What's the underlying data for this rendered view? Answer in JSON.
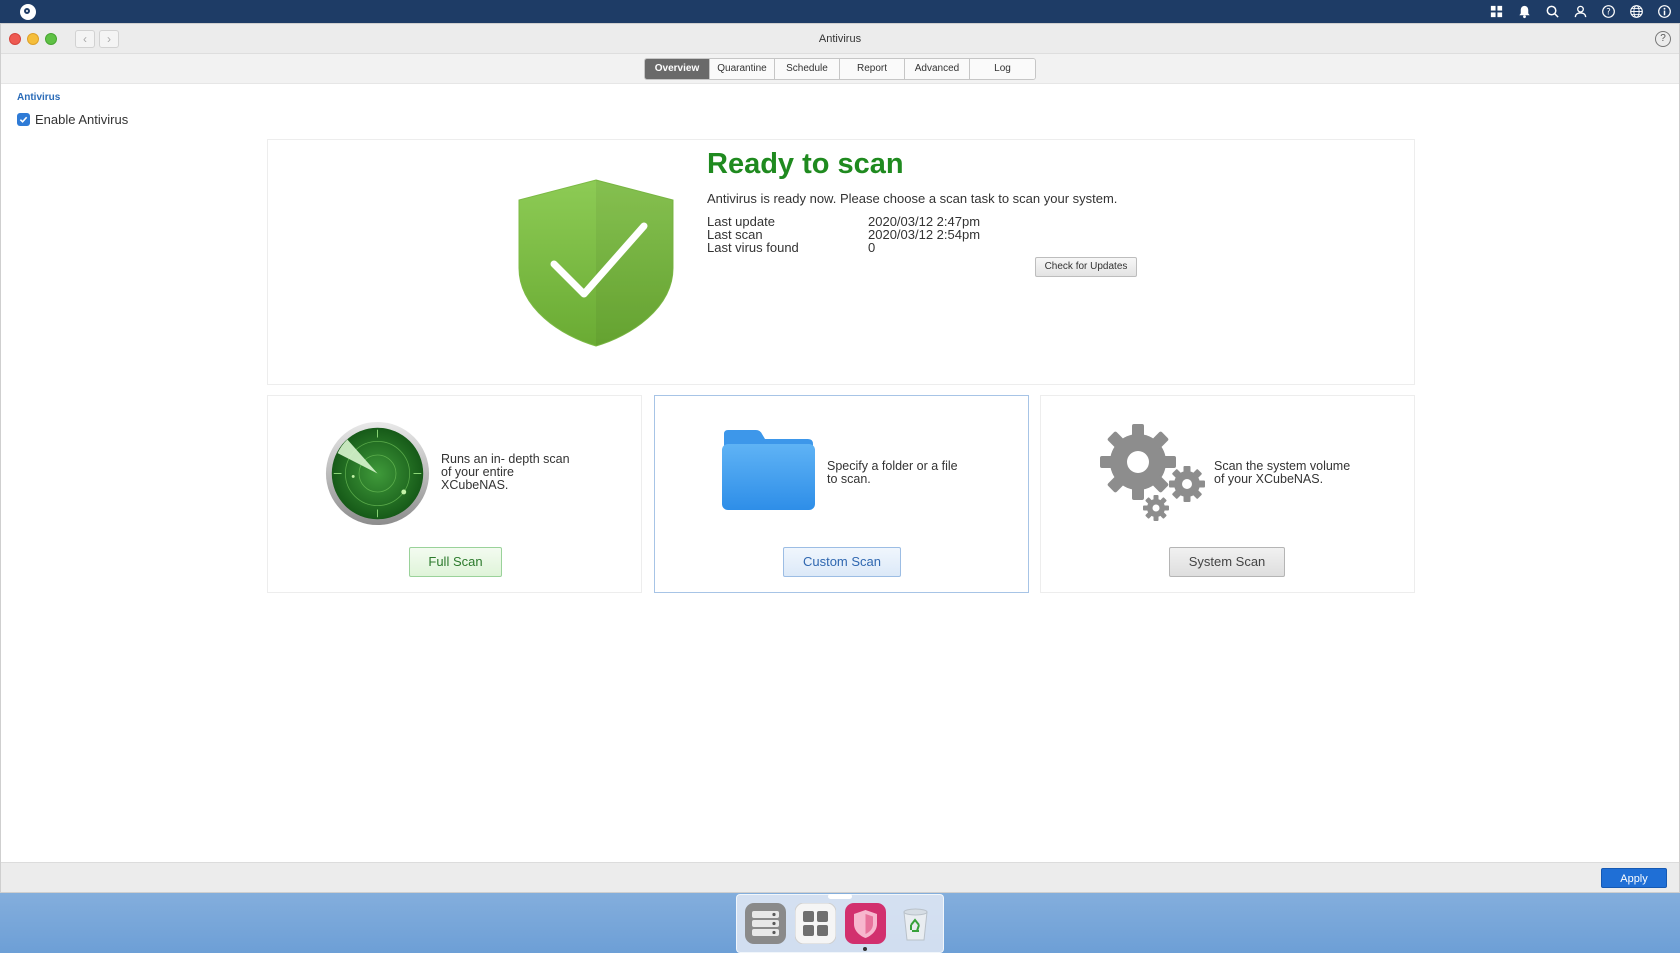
{
  "window": {
    "title": "Antivirus",
    "help": "?"
  },
  "nav": {
    "back": "‹",
    "forward": "›"
  },
  "tabs": [
    {
      "label": "Overview",
      "active": true
    },
    {
      "label": "Quarantine",
      "active": false
    },
    {
      "label": "Schedule",
      "active": false
    },
    {
      "label": "Report",
      "active": false
    },
    {
      "label": "Advanced",
      "active": false
    },
    {
      "label": "Log",
      "active": false
    }
  ],
  "section": {
    "title": "Antivirus",
    "enable_label": "Enable Antivirus",
    "enable_checked": true
  },
  "status": {
    "heading": "Ready to scan",
    "description": "Antivirus is ready now. Please choose a scan task to scan your system.",
    "info": [
      {
        "label": "Last update",
        "value": "2020/03/12 2:47pm"
      },
      {
        "label": "Last scan",
        "value": "2020/03/12 2:54pm"
      },
      {
        "label": "Last virus found",
        "value": "0"
      }
    ],
    "check_updates_label": "Check for Updates"
  },
  "scans": {
    "full": {
      "desc_lines": [
        "Runs an in- depth scan",
        "of your entire",
        "XCubeNAS."
      ],
      "button": "Full Scan"
    },
    "custom": {
      "desc_lines": [
        "Specify a folder or a file",
        "to scan."
      ],
      "button": "Custom Scan"
    },
    "system": {
      "desc_lines": [
        "Scan the system volume",
        "of your XCubeNAS."
      ],
      "button": "System Scan"
    }
  },
  "footer": {
    "apply_label": "Apply"
  },
  "colors": {
    "accent": "#1f6fd6",
    "ready_green": "#1f8a1f",
    "system_bar": "#1e3c66"
  },
  "icons": {
    "system_bar": [
      "apps-grid-icon",
      "bell-icon",
      "search-icon",
      "user-icon",
      "help-icon",
      "globe-icon",
      "info-icon"
    ],
    "dock": [
      "storage-manager-icon",
      "app-center-icon",
      "antivirus-icon",
      "recycle-bin-icon"
    ]
  }
}
